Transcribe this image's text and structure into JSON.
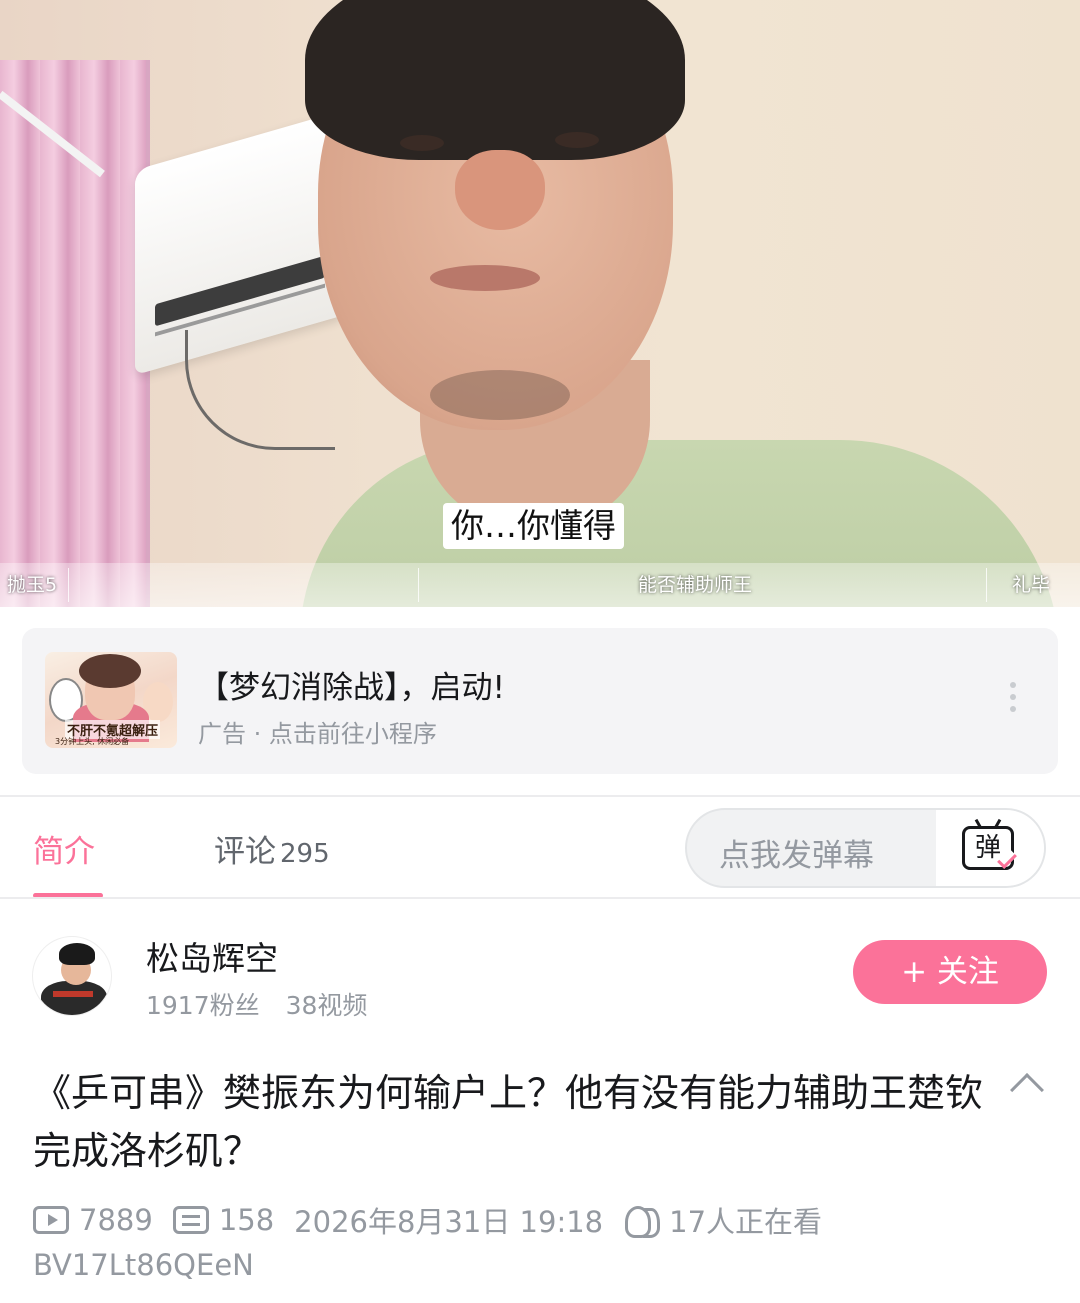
{
  "video": {
    "subtitle": "你…你懂得",
    "danmaku": [
      "抛玉5",
      "能否辅助师王",
      "礼毕"
    ]
  },
  "ad": {
    "title": "【梦幻消除战】，启动!",
    "subtitle": "广告 · 点击前往小程序",
    "thumb_text": "不肝不氪超解压",
    "thumb_subtext": "3分钟上头, 休闲必备"
  },
  "tabs": {
    "intro": "简介",
    "comments": "评论",
    "comments_count": "295"
  },
  "danmaku_input": {
    "placeholder": "点我发弹幕",
    "icon_char": "弹"
  },
  "uploader": {
    "name": "松岛辉空",
    "fans": "1917粉丝",
    "videos": "38视频",
    "follow_label": "+ 关注"
  },
  "video_info": {
    "title": "《乒可串》樊振东为何输户上？他有没有能力辅助王楚钦完成洛杉矶？",
    "views": "7889",
    "danmaku_count": "158",
    "date": "2026年8月31日 19:18",
    "watching": "17人正在看",
    "bvid": "BV17Lt86QEeN"
  },
  "colors": {
    "accent": "#fb7299",
    "secondary_text": "#9499a0"
  },
  "icons": [
    "play-count-icon",
    "danmaku-count-icon",
    "watching-people-icon",
    "collapse-chevron-icon",
    "more-dots-icon",
    "danmaku-send-icon"
  ]
}
